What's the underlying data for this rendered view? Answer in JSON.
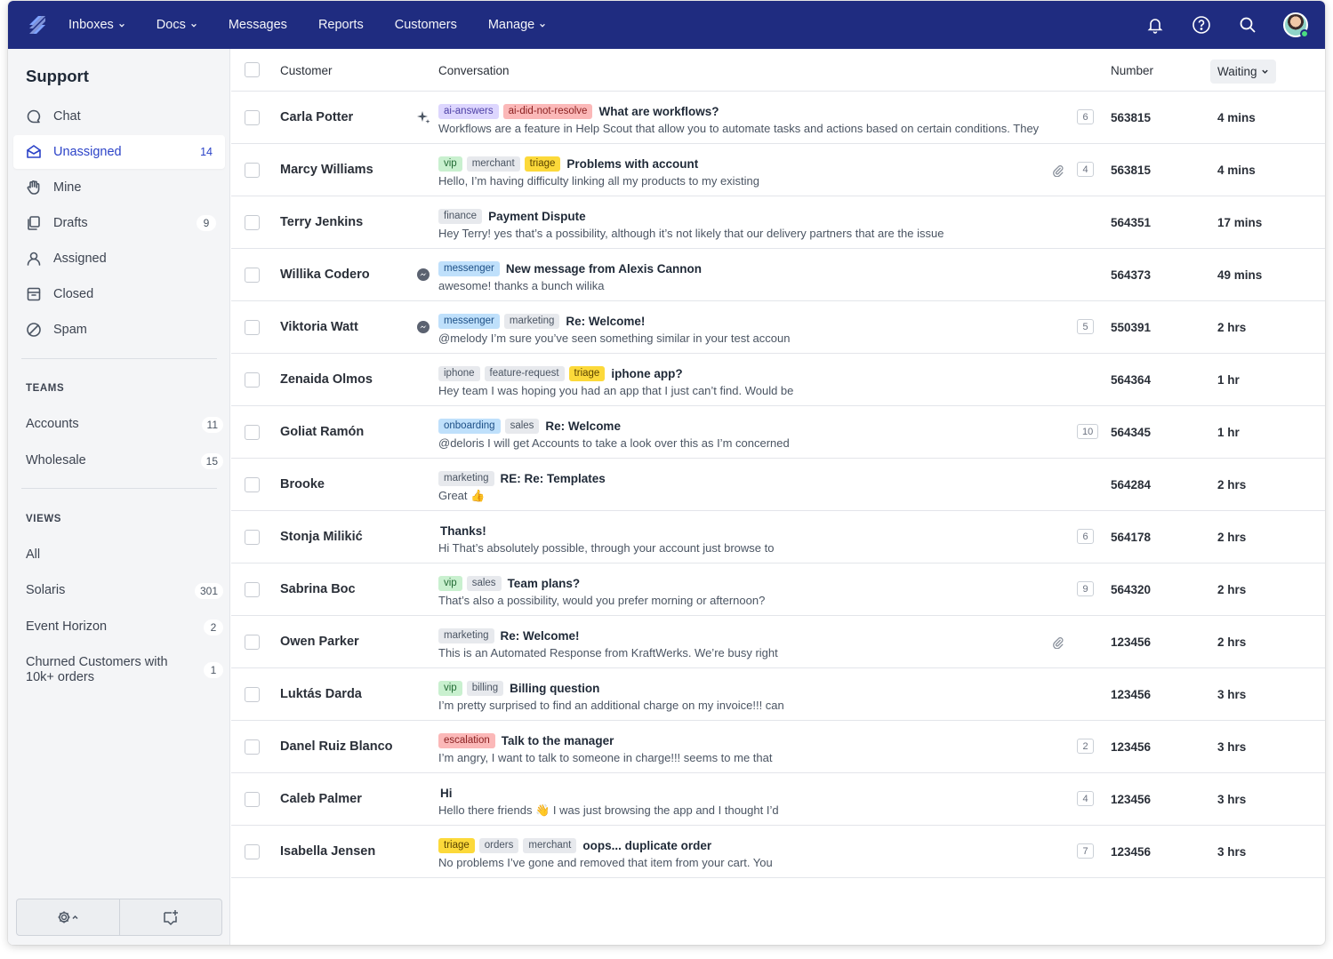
{
  "colors": {
    "nav_bg": "#1f2c80",
    "accent": "#2c43c8",
    "tag_default": "#e7e9ed",
    "tag_purple": "#ddd6fe",
    "tag_red": "#fbb8b8",
    "tag_green": "#c9f0cf",
    "tag_yellow": "#fcd93a",
    "tag_blue": "#bfe0fb"
  },
  "topnav": {
    "items": [
      {
        "label": "Inboxes",
        "dropdown": true,
        "active": true
      },
      {
        "label": "Docs",
        "dropdown": true
      },
      {
        "label": "Messages",
        "dropdown": false
      },
      {
        "label": "Reports",
        "dropdown": false
      },
      {
        "label": "Customers",
        "dropdown": false
      },
      {
        "label": "Manage",
        "dropdown": true
      }
    ],
    "icons": [
      "bell-icon",
      "help-icon",
      "search-icon",
      "avatar"
    ]
  },
  "sidebar": {
    "title": "Support",
    "folders": [
      {
        "label": "Chat",
        "icon": "chat-icon",
        "count": ""
      },
      {
        "label": "Unassigned",
        "icon": "inbox-icon",
        "count": "14",
        "active": true
      },
      {
        "label": "Mine",
        "icon": "hand-icon",
        "count": ""
      },
      {
        "label": "Drafts",
        "icon": "drafts-icon",
        "count": "9"
      },
      {
        "label": "Assigned",
        "icon": "person-icon",
        "count": ""
      },
      {
        "label": "Closed",
        "icon": "archive-icon",
        "count": ""
      },
      {
        "label": "Spam",
        "icon": "spam-icon",
        "count": ""
      }
    ],
    "teams_heading": "TEAMS",
    "teams": [
      {
        "label": "Accounts",
        "count": "11"
      },
      {
        "label": "Wholesale",
        "count": "15"
      }
    ],
    "views_heading": "VIEWS",
    "views": [
      {
        "label": "All",
        "count": ""
      },
      {
        "label": "Solaris",
        "count": "301"
      },
      {
        "label": "Event Horizon",
        "count": "2"
      },
      {
        "label": "Churned Customers with 10k+ orders",
        "count": "1"
      }
    ]
  },
  "table": {
    "headers": {
      "customer": "Customer",
      "conversation": "Conversation",
      "number": "Number",
      "sort": "Waiting"
    },
    "rows": [
      {
        "customer": "Carla Potter",
        "channel": "ai",
        "tags": [
          {
            "t": "ai-answers",
            "c": "purple"
          },
          {
            "t": "ai-did-not-resolve",
            "c": "red"
          }
        ],
        "subject": "What are workflows?",
        "preview": "Workflows are a feature in Help Scout that allow you to automate tasks and actions based on certain conditions. They",
        "attach": false,
        "threads": "6",
        "number": "563815",
        "waiting": "4 mins"
      },
      {
        "customer": "Marcy Williams",
        "channel": "",
        "tags": [
          {
            "t": "vip",
            "c": "green"
          },
          {
            "t": "merchant",
            "c": "default"
          },
          {
            "t": "triage",
            "c": "yellow"
          }
        ],
        "subject": "Problems with account",
        "preview": "Hello, I’m having difficulty linking all my products to my existing",
        "attach": true,
        "threads": "4",
        "number": "563815",
        "waiting": "4 mins"
      },
      {
        "customer": "Terry Jenkins",
        "channel": "",
        "tags": [
          {
            "t": "finance",
            "c": "default"
          }
        ],
        "subject": "Payment Dispute",
        "preview": "Hey Terry! yes that’s a possibility, although it’s not likely that our delivery partners that are the issue",
        "attach": false,
        "threads": "",
        "number": "564351",
        "waiting": "17 mins"
      },
      {
        "customer": "Willika Codero",
        "channel": "messenger",
        "tags": [
          {
            "t": "messenger",
            "c": "blue"
          }
        ],
        "subject": "New message from Alexis Cannon",
        "preview": "awesome! thanks a bunch wilika",
        "attach": false,
        "threads": "",
        "number": "564373",
        "waiting": "49 mins"
      },
      {
        "customer": "Viktoria Watt",
        "channel": "messenger",
        "tags": [
          {
            "t": "messenger",
            "c": "blue"
          },
          {
            "t": "marketing",
            "c": "default"
          }
        ],
        "subject": "Re: Welcome!",
        "preview": "@melody I’m sure you’ve seen something similar in your test accoun",
        "attach": false,
        "threads": "5",
        "number": "550391",
        "waiting": "2 hrs"
      },
      {
        "customer": "Zenaida Olmos",
        "channel": "",
        "tags": [
          {
            "t": "iphone",
            "c": "default"
          },
          {
            "t": "feature-request",
            "c": "default"
          },
          {
            "t": "triage",
            "c": "yellow"
          }
        ],
        "subject": "iphone app?",
        "preview": "Hey team I was hoping you had an app that I just can’t find. Would be",
        "attach": false,
        "threads": "",
        "number": "564364",
        "waiting": "1 hr"
      },
      {
        "customer": "Goliat Ramón",
        "channel": "",
        "tags": [
          {
            "t": "onboarding",
            "c": "blue"
          },
          {
            "t": "sales",
            "c": "default"
          }
        ],
        "subject": "Re: Welcome",
        "preview": "@deloris I will get Accounts to take a look over this as I’m concerned",
        "attach": false,
        "threads": "10",
        "number": "564345",
        "waiting": "1 hr"
      },
      {
        "customer": "Brooke",
        "channel": "",
        "tags": [
          {
            "t": "marketing",
            "c": "default"
          }
        ],
        "subject": "RE: Re: Templates",
        "preview": "Great 👍",
        "attach": false,
        "threads": "",
        "number": "564284",
        "waiting": "2 hrs"
      },
      {
        "customer": "Stonja Milikić",
        "channel": "",
        "tags": [],
        "subject": "Thanks!",
        "preview": "Hi That’s absolutely possible, through your account just browse to",
        "attach": false,
        "threads": "6",
        "number": "564178",
        "waiting": "2 hrs"
      },
      {
        "customer": "Sabrina Boc",
        "channel": "",
        "tags": [
          {
            "t": "vip",
            "c": "green"
          },
          {
            "t": "sales",
            "c": "default"
          }
        ],
        "subject": "Team plans?",
        "preview": "That’s also a possibility, would you prefer morning or afternoon?",
        "attach": false,
        "threads": "9",
        "number": "564320",
        "waiting": "2 hrs"
      },
      {
        "customer": "Owen Parker",
        "channel": "",
        "tags": [
          {
            "t": "marketing",
            "c": "default"
          }
        ],
        "subject": "Re: Welcome!",
        "preview": "This is an Automated Response from KraftWerks. We’re busy right",
        "attach": true,
        "threads": "",
        "number": "123456",
        "waiting": "2 hrs"
      },
      {
        "customer": "Luktás Darda",
        "channel": "",
        "tags": [
          {
            "t": "vip",
            "c": "green"
          },
          {
            "t": "billing",
            "c": "default"
          }
        ],
        "subject": "Billing question",
        "preview": "I’m pretty surprised to find an additional charge on my invoice!!! can",
        "attach": false,
        "threads": "",
        "number": "123456",
        "waiting": "3 hrs"
      },
      {
        "customer": "Danel Ruiz Blanco",
        "channel": "",
        "tags": [
          {
            "t": "escalation",
            "c": "red"
          }
        ],
        "subject": "Talk to the manager",
        "preview": "I’m angry, I want to talk to someone in charge!!! seems to me that",
        "attach": false,
        "threads": "2",
        "number": "123456",
        "waiting": "3 hrs"
      },
      {
        "customer": "Caleb Palmer",
        "channel": "",
        "tags": [],
        "subject": "Hi",
        "preview": "Hello there friends 👋 I was just browsing the app and I thought I’d",
        "attach": false,
        "threads": "4",
        "number": "123456",
        "waiting": "3 hrs"
      },
      {
        "customer": "Isabella Jensen",
        "channel": "",
        "tags": [
          {
            "t": "triage",
            "c": "yellow"
          },
          {
            "t": "orders",
            "c": "default"
          },
          {
            "t": "merchant",
            "c": "default"
          }
        ],
        "subject": "oops... duplicate order",
        "preview": "No problems I’ve gone and removed that item from your cart. You",
        "attach": false,
        "threads": "7",
        "number": "123456",
        "waiting": "3 hrs"
      }
    ]
  }
}
